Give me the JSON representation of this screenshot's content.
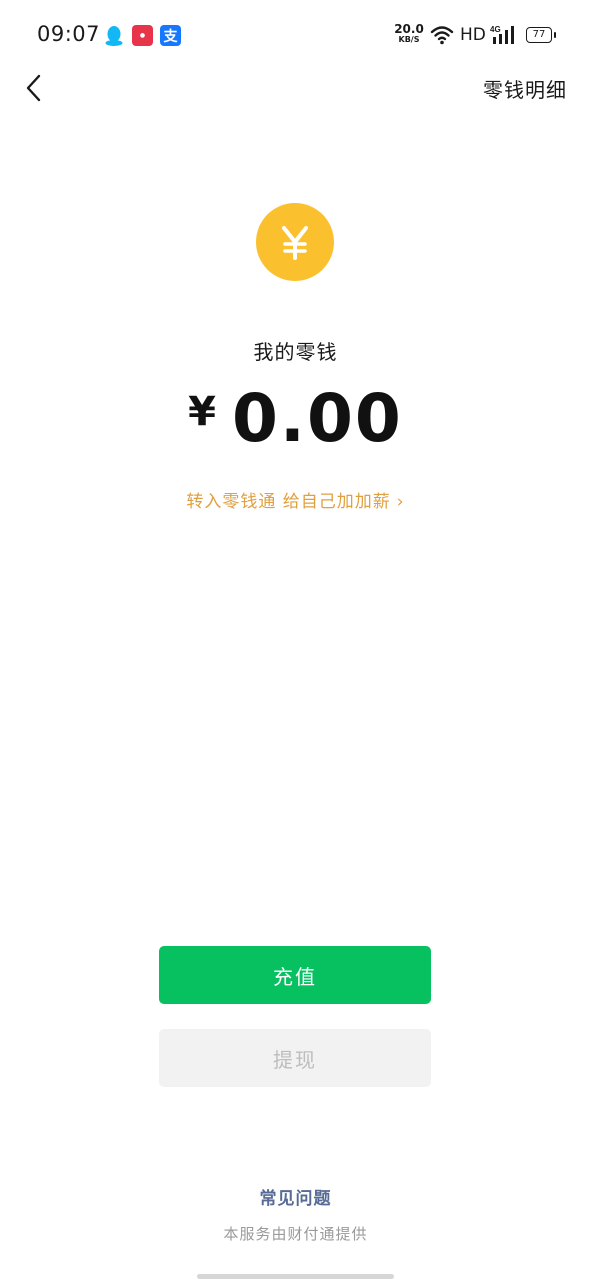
{
  "status_bar": {
    "time": "09:07",
    "net_speed_value": "20.0",
    "net_speed_unit": "KB/S",
    "hd_label": "HD",
    "signal_label": "4G",
    "battery_level": "77",
    "notification_icons": [
      "qq-icon",
      "red-app-icon",
      "alipay-icon"
    ]
  },
  "nav": {
    "back_icon": "chevron-left-icon",
    "detail_link": "零钱明细"
  },
  "balance": {
    "coin_symbol": "¥",
    "label": "我的零钱",
    "currency": "¥",
    "amount": "0.00",
    "promo_text": "转入零钱通 给自己加加薪",
    "promo_chevron": "›"
  },
  "actions": {
    "recharge_label": "充值",
    "withdraw_label": "提现"
  },
  "footer": {
    "faq_label": "常见问题",
    "provider_note": "本服务由财付通提供"
  },
  "colors": {
    "accent_green": "#07c160",
    "coin_yellow": "#fbc02d",
    "promo_orange": "#e0a040",
    "link_blue": "#576b95"
  }
}
